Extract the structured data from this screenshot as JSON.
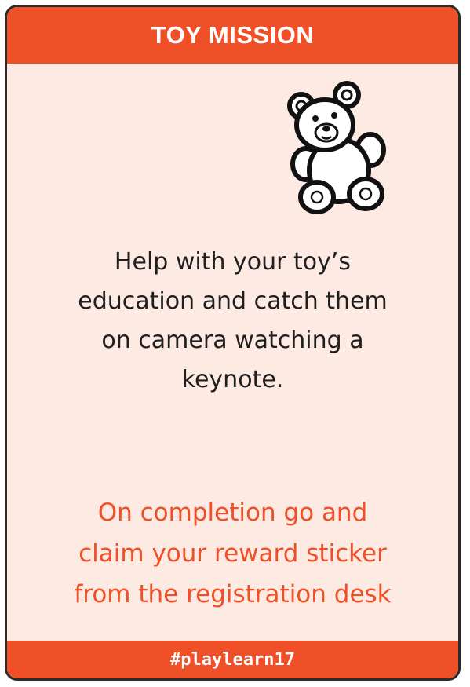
{
  "card": {
    "title": "TOY MISSION",
    "icon": "teddy-bear-icon",
    "mission": "Help with your toy’s\neducation and catch them\non camera watching a\nkeynote.",
    "reward": "On completion go and\nclaim your reward sticker\nfrom the registration desk",
    "hashtag": "#playlearn17"
  },
  "colors": {
    "accent": "#ef5027",
    "card_background": "#fdeae3",
    "border": "#2b2b2b",
    "body_text": "#1f1f1f",
    "header_text": "#ffffff"
  }
}
